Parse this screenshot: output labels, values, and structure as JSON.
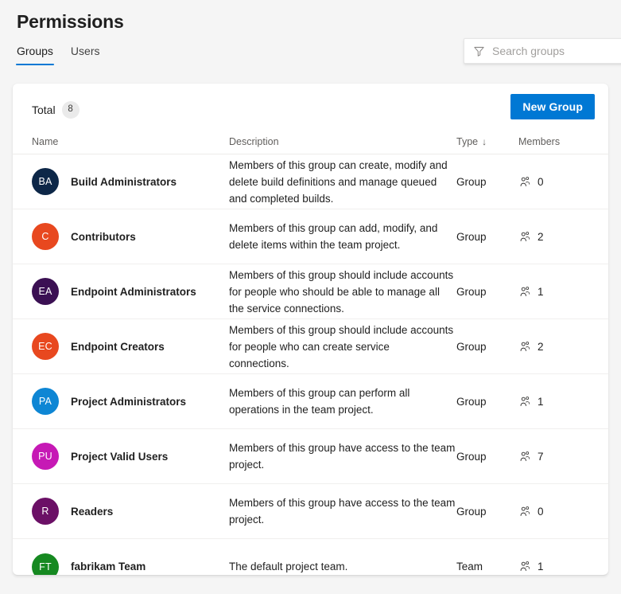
{
  "header": {
    "title": "Permissions",
    "tabs": [
      {
        "label": "Groups",
        "active": true
      },
      {
        "label": "Users",
        "active": false
      }
    ],
    "search": {
      "placeholder": "Search groups",
      "value": "",
      "icon": "filter-icon"
    }
  },
  "toolbar": {
    "total_label": "Total",
    "total_count": "8",
    "new_group_label": "New Group",
    "accent_color": "#0078d4"
  },
  "table": {
    "columns": [
      {
        "key": "name",
        "label": "Name",
        "sorted": false
      },
      {
        "key": "description",
        "label": "Description",
        "sorted": false
      },
      {
        "key": "type",
        "label": "Type",
        "sorted": true,
        "sort_icon": "↓"
      },
      {
        "key": "members",
        "label": "Members",
        "sorted": false
      }
    ],
    "rows": [
      {
        "initials": "BA",
        "avatar_color": "#0d2748",
        "name": "Build Administrators",
        "description": "Members of this group can create, modify and delete build definitions and manage queued and completed builds.",
        "type": "Group",
        "members": "0"
      },
      {
        "initials": "C",
        "avatar_color": "#e8481f",
        "name": "Contributors",
        "description": "Members of this group can add, modify, and delete items within the team project.",
        "type": "Group",
        "members": "2"
      },
      {
        "initials": "EA",
        "avatar_color": "#3b1053",
        "name": "Endpoint Administrators",
        "description": "Members of this group should include accounts for people who should be able to manage all the service connections.",
        "type": "Group",
        "members": "1"
      },
      {
        "initials": "EC",
        "avatar_color": "#e8481f",
        "name": "Endpoint Creators",
        "description": "Members of this group should include accounts for people who can create service connections.",
        "type": "Group",
        "members": "2"
      },
      {
        "initials": "PA",
        "avatar_color": "#0e86d4",
        "name": "Project Administrators",
        "description": "Members of this group can perform all operations in the team project.",
        "type": "Group",
        "members": "1"
      },
      {
        "initials": "PU",
        "avatar_color": "#c619b5",
        "name": "Project Valid Users",
        "description": "Members of this group have access to the team project.",
        "type": "Group",
        "members": "7"
      },
      {
        "initials": "R",
        "avatar_color": "#6b1066",
        "name": "Readers",
        "description": "Members of this group have access to the team project.",
        "type": "Group",
        "members": "0"
      },
      {
        "initials": "FT",
        "avatar_color": "#168921",
        "name": "fabrikam Team",
        "description": "The default project team.",
        "type": "Team",
        "members": "1"
      }
    ]
  }
}
